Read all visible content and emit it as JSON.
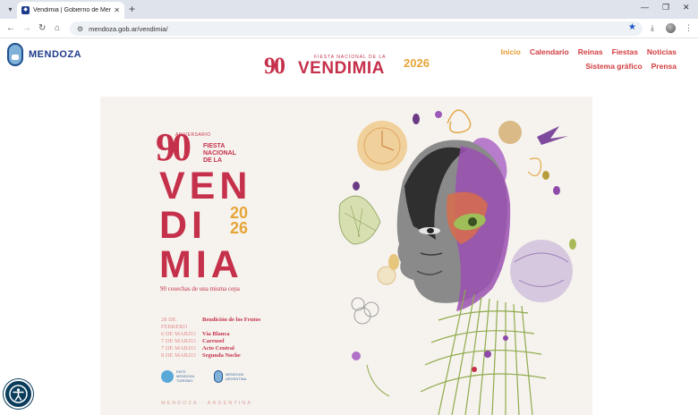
{
  "browser": {
    "tab_title": "Vendimia | Gobierno de Mendoza",
    "url": "mendoza.gob.ar/vendimia/"
  },
  "site": {
    "logo_text": "MENDOZA",
    "header_brand": {
      "number": "90",
      "small": "FIESTA NACIONAL DE LA",
      "word": "VENDIMIA",
      "year": "2026"
    },
    "nav": {
      "row1": [
        "Inicio",
        "Calendario",
        "Reinas",
        "Fiestas",
        "Noticias"
      ],
      "row2": [
        "Sistema gráfico",
        "Prensa"
      ],
      "active": "Inicio",
      "accent": "#d23c3f",
      "active_color": "#e79b33"
    }
  },
  "poster": {
    "number": "90",
    "aniversario": "ANIVERSARIO",
    "fiesta_lines": [
      "FIESTA",
      "NACIONAL",
      "DE LA"
    ],
    "big_lines": [
      "VEN",
      "DI",
      "MIA"
    ],
    "year_top": "20",
    "year_bottom": "26",
    "tagline": "90 cosechas de una misma cepa",
    "events": [
      {
        "date": "28 DE FEBRERO",
        "name": "Bendición de los Frutos"
      },
      {
        "date": "6 DE MARZO",
        "name": "Vía Blanca"
      },
      {
        "date": "7 DE MARZO",
        "name": "Carrusel"
      },
      {
        "date": "7 DE MARZO",
        "name": "Acto Central"
      },
      {
        "date": "8 DE MARZO",
        "name": "Segunda Noche"
      }
    ],
    "footer": "MENDOZA · ARGENTINA",
    "logo_labels": [
      "ENTE MENDOZA TURISMO",
      "MENDOZA ARGENTINA"
    ],
    "colors": {
      "primary": "#c5304a",
      "gold": "#e6a537",
      "bg": "#f6f3ee"
    }
  }
}
